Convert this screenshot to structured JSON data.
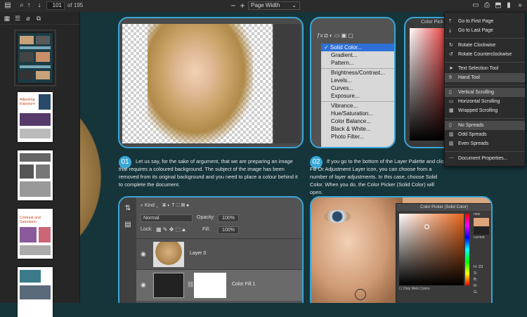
{
  "toolbar": {
    "page_number": "101",
    "page_of": "of 195",
    "zoom": "Page Width",
    "zoom_minus": "−",
    "zoom_plus": "+"
  },
  "menu": {
    "items": [
      {
        "label": "Go to First Page",
        "icon": "first-page-icon"
      },
      {
        "label": "Go to Last Page",
        "icon": "last-page-icon"
      },
      {
        "label": "Rotate Clockwise",
        "icon": "rotate-cw-icon"
      },
      {
        "label": "Rotate Counterclockwise",
        "icon": "rotate-ccw-icon"
      },
      {
        "label": "Text Selection Tool",
        "icon": "cursor-icon"
      },
      {
        "label": "Hand Tool",
        "icon": "hand-icon"
      },
      {
        "label": "Vertical Scrolling",
        "icon": "vertical-scroll-icon"
      },
      {
        "label": "Horizontal Scrolling",
        "icon": "horizontal-scroll-icon"
      },
      {
        "label": "Wrapped Scrolling",
        "icon": "wrapped-scroll-icon"
      },
      {
        "label": "No Spreads",
        "icon": "no-spreads-icon"
      },
      {
        "label": "Odd Spreads",
        "icon": "odd-spreads-icon"
      },
      {
        "label": "Even Spreads",
        "icon": "even-spreads-icon"
      },
      {
        "label": "Document Properties...",
        "icon": "properties-icon"
      }
    ]
  },
  "thumbnails": {
    "t2_title": "Adjusting Exposure",
    "t4_title": "Contrast and Saturation"
  },
  "article": {
    "step1_num": "01",
    "step1_text": "Let us say, for the sake of argument, that we are preparing an image that requires a coloured background. The subject of the image has been removed from its original background and you need to place a colour behind it to complete the document.",
    "step2_num": "02",
    "step2_text": "If you go to the bottom of the Layer Palette and click Fill Or Adjustment Layer icon, you can choose from a number of layer adjustments. In this case, choose Solid Color. When you do, the Color Picker (Solid Color) will open."
  },
  "ps_menu": {
    "items": [
      "✓ Solid Color...",
      "Gradient...",
      "Pattern...",
      "Brightness/Contrast...",
      "Levels...",
      "Curves...",
      "Exposure...",
      "Vibrance...",
      "Hue/Saturation...",
      "Color Balance...",
      "Black & White...",
      "Photo Filter..."
    ]
  },
  "picker_tab": "Color Pick",
  "layers_panel": {
    "kind": "Kind",
    "blend": "Normal",
    "opacity_label": "Opacity:",
    "opacity": "100%",
    "lock_label": "Lock:",
    "fill_label": "Fill:",
    "fill": "100%",
    "layer0": "Layer 0",
    "layer1": "Color Fill 1"
  },
  "color_picker": {
    "title": "Color Picker (Solid Color)",
    "new_label": "new",
    "current_label": "current",
    "only_web": "Only Web Colors",
    "h_label": "H:",
    "h_value": "23",
    "s_label": "S:",
    "b_label": "B:",
    "r_label": "R:",
    "g_label": "G:"
  }
}
